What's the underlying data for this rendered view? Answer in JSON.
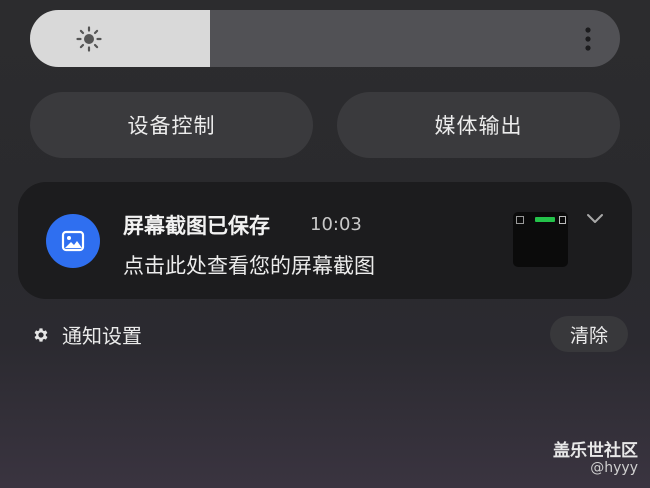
{
  "brightness": {
    "level": 0.305,
    "icon": "sun-icon",
    "menu_icon": "more-vertical-icon"
  },
  "quick_buttons": {
    "device_control": "设备控制",
    "media_output": "媒体输出"
  },
  "notification": {
    "app_icon": "image-icon",
    "app_icon_color": "#2f6ff0",
    "title": "屏幕截图已保存",
    "time": "10:03",
    "body": "点击此处查看您的屏幕截图",
    "expand_icon": "chevron-down-icon"
  },
  "footer": {
    "settings_label": "通知设置",
    "clear_label": "清除"
  },
  "watermark": {
    "brand": "盖乐世社区",
    "user": "@hyyy"
  }
}
